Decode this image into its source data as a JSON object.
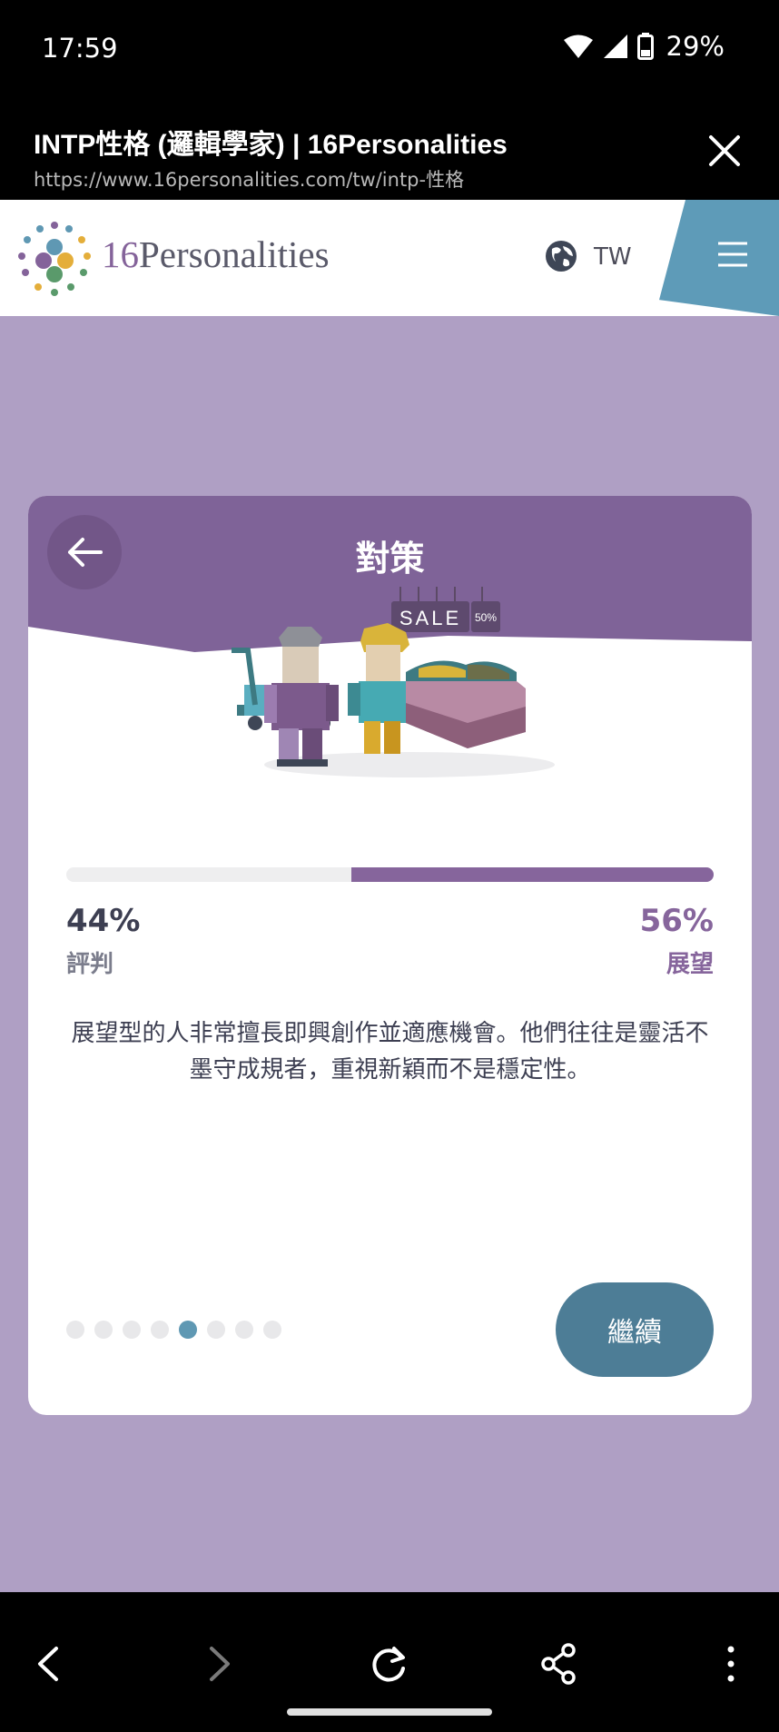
{
  "status": {
    "time": "17:59",
    "battery": "29%"
  },
  "browser": {
    "title": "INTP性格 (邏輯學家) | 16Personalities",
    "url": "https://www.16personalities.com/tw/intp-性格"
  },
  "site": {
    "logo_number": "16",
    "logo_word": "Personalities",
    "language": "TW"
  },
  "card": {
    "title": "對策",
    "left_percent": "44%",
    "left_label": "評判",
    "right_percent": "56%",
    "right_label": "展望",
    "right_fraction": 0.56,
    "description": "展望型的人非常擅長即興創作並適應機會。他們往往是靈活不墨守成規者，重視新穎而不是穩定性。",
    "sale_tag": "SALE",
    "discount_tag": "50%",
    "continue_label": "繼續",
    "pagination": {
      "total": 8,
      "active_index": 4
    }
  },
  "colors": {
    "accent_purple": "#86659c",
    "header_purple": "#7f6398",
    "page_bg": "#af9fc4",
    "button_blue": "#4d7d96",
    "menu_blue": "#5e9bb8"
  },
  "icons": [
    "wifi-icon",
    "signal-icon",
    "battery-icon",
    "close-icon",
    "globe-icon",
    "menu-icon",
    "back-arrow-icon",
    "nav-back-icon",
    "nav-forward-icon",
    "reload-icon",
    "share-icon",
    "more-icon"
  ]
}
